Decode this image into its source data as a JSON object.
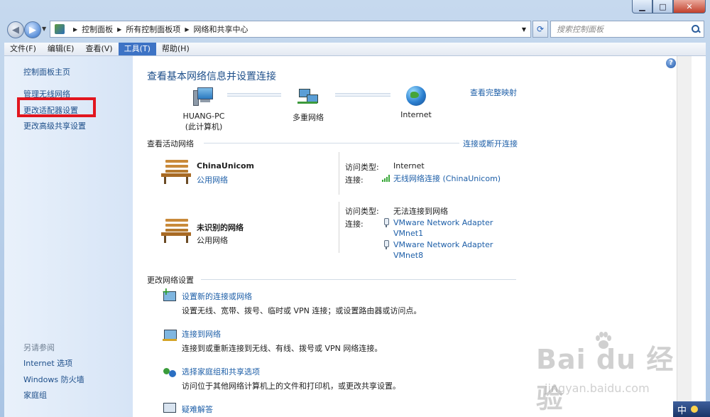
{
  "window": {
    "minimize_glyph": "▁",
    "maximize_glyph": "□",
    "close_glyph": "✕"
  },
  "address_bar": {
    "crumbs": [
      "控制面板",
      "所有控制面板项",
      "网络和共享中心"
    ],
    "search_placeholder": "搜索控制面板"
  },
  "menu": {
    "items": [
      "文件(F)",
      "编辑(E)",
      "查看(V)",
      "工具(T)",
      "帮助(H)"
    ],
    "active_index": 3
  },
  "sidebar": {
    "home": "控制面板主页",
    "links": [
      "管理无线网络",
      "更改适配器设置",
      "更改高级共享设置"
    ],
    "see_also_heading": "另请参阅",
    "see_also": [
      "Internet 选项",
      "Windows 防火墙",
      "家庭组"
    ]
  },
  "main": {
    "title": "查看基本网络信息并设置连接",
    "view_full_map": "查看完整映射",
    "map": {
      "pc_name": "HUANG-PC",
      "pc_sub": "(此计算机)",
      "middle": "多重网络",
      "internet": "Internet"
    },
    "active_networks": {
      "heading": "查看活动网络",
      "connect_link": "连接或断开连接",
      "networks": [
        {
          "name": "ChinaUnicom",
          "type": "公用网络",
          "access_type_label": "访问类型:",
          "access_type": "Internet",
          "connection_label": "连接:",
          "connections": [
            "无线网络连接 (ChinaUnicom)"
          ]
        },
        {
          "name": "未识别的网络",
          "type": "公用网络",
          "access_type_label": "访问类型:",
          "access_type": "无法连接到网络",
          "connection_label": "连接:",
          "connections": [
            "VMware Network Adapter VMnet1",
            "VMware Network Adapter VMnet8"
          ]
        }
      ]
    },
    "change_settings": {
      "heading": "更改网络设置",
      "tasks": [
        {
          "title": "设置新的连接或网络",
          "desc": "设置无线、宽带、拨号、临时或 VPN 连接；或设置路由器或访问点。",
          "icon": "new-connection-icon"
        },
        {
          "title": "连接到网络",
          "desc": "连接到或重新连接到无线、有线、拨号或 VPN 网络连接。",
          "icon": "connect-network-icon"
        },
        {
          "title": "选择家庭组和共享选项",
          "desc": "访问位于其他网络计算机上的文件和打印机，或更改共享设置。",
          "icon": "homegroup-icon"
        },
        {
          "title": "疑难解答",
          "desc": "",
          "icon": "troubleshoot-icon"
        }
      ]
    }
  },
  "watermark": {
    "brand": "Bai du 经验",
    "url": "jingyan.baidu.com"
  },
  "ime": {
    "label": "中"
  },
  "colors": {
    "link": "#1e5fa8",
    "highlight_box": "#e2161f",
    "menu_active": "#3d73c5"
  }
}
